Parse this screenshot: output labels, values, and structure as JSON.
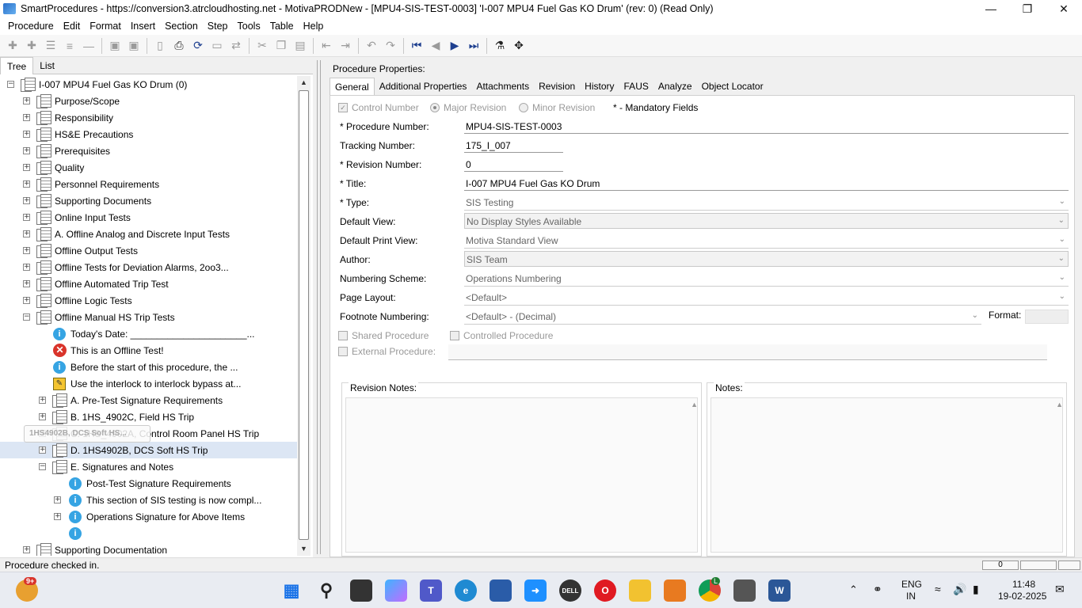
{
  "window": {
    "title": "SmartProcedures - https://conversion3.atrcloudhosting.net - MotivaPRODNew - [MPU4-SIS-TEST-0003] 'I-007 MPU4 Fuel Gas KO Drum' (rev: 0) (Read Only)"
  },
  "menu": [
    "Procedure",
    "Edit",
    "Format",
    "Insert",
    "Section",
    "Step",
    "Tools",
    "Table",
    "Help"
  ],
  "left_tabs": [
    "Tree",
    "List"
  ],
  "tree": [
    {
      "label": "I-007 MPU4 Fuel Gas KO Drum (0)"
    },
    {
      "label": "Purpose/Scope"
    },
    {
      "label": "Responsibility"
    },
    {
      "label": "HS&E Precautions"
    },
    {
      "label": "Prerequisites"
    },
    {
      "label": "Quality"
    },
    {
      "label": "Personnel Requirements"
    },
    {
      "label": "Supporting Documents"
    },
    {
      "label": "Online Input Tests"
    },
    {
      "label": "A. Offline Analog and Discrete Input Tests"
    },
    {
      "label": "Offline Output Tests"
    },
    {
      "label": "Offline Tests for Deviation Alarms, 2oo3..."
    },
    {
      "label": "Offline Automated Trip Test"
    },
    {
      "label": "Offline Logic Tests"
    },
    {
      "label": "Offline Manual HS Trip Tests"
    },
    {
      "label": "Today's Date: ______________________..."
    },
    {
      "label": "This is an Offline Test!"
    },
    {
      "label": "Before the start of this procedure, the ..."
    },
    {
      "label": "Use the interlock to interlock bypass at..."
    },
    {
      "label": "A. Pre-Test Signature Requirements"
    },
    {
      "label": "B. 1HS_4902C, Field HS Trip"
    },
    {
      "label": "C. 1HS_4902A, Control Room Panel HS Trip"
    },
    {
      "label": "D. 1HS4902B, DCS Soft HS Trip"
    },
    {
      "label": "E. Signatures and Notes"
    },
    {
      "label": "Post-Test Signature Requirements"
    },
    {
      "label": "This section of SIS testing is now compl..."
    },
    {
      "label": "Operations Signature for Above Items"
    },
    {
      "label": ""
    },
    {
      "label": "Supporting Documentation"
    }
  ],
  "tooltip": "1HS4902B, DCS Soft HS...",
  "props": {
    "title": "Procedure Properties:",
    "tabs": [
      "General",
      "Additional Properties",
      "Attachments",
      "Revision",
      "History",
      "FAUS",
      "Analyze",
      "Object Locator"
    ],
    "control_number": "Control Number",
    "major_revision": "Major Revision",
    "minor_revision": "Minor Revision",
    "mandatory": "* - Mandatory Fields",
    "fields": {
      "procedure_number": {
        "label": "* Procedure Number:",
        "value": "MPU4-SIS-TEST-0003"
      },
      "tracking_number": {
        "label": "Tracking Number:",
        "value": "175_I_007"
      },
      "revision_number": {
        "label": "* Revision Number:",
        "value": "0"
      },
      "title": {
        "label": "* Title:",
        "value": "I-007 MPU4 Fuel Gas KO Drum"
      },
      "type": {
        "label": "* Type:",
        "value": "SIS Testing"
      },
      "default_view": {
        "label": "Default View:",
        "value": "No Display Styles Available"
      },
      "default_print_view": {
        "label": "Default Print View:",
        "value": "Motiva Standard View"
      },
      "author": {
        "label": "Author:",
        "value": "SIS Team"
      },
      "numbering_scheme": {
        "label": "Numbering Scheme:",
        "value": "Operations Numbering"
      },
      "page_layout": {
        "label": "Page Layout:",
        "value": "<Default>"
      },
      "footnote_numbering": {
        "label": "Footnote Numbering:",
        "value": "<Default> - (Decimal)"
      }
    },
    "format_label": "Format:",
    "shared_procedure": "Shared Procedure",
    "controlled_procedure": "Controlled Procedure",
    "external_procedure": "External Procedure:",
    "revision_notes": "Revision Notes:",
    "notes": "Notes:"
  },
  "status": {
    "text": "Procedure checked in.",
    "page": "0"
  },
  "taskbar": {
    "badge": "9+",
    "lang1": "ENG",
    "lang2": "IN",
    "time": "11:48",
    "date": "19-02-2025",
    "chrome_badge": "L"
  }
}
